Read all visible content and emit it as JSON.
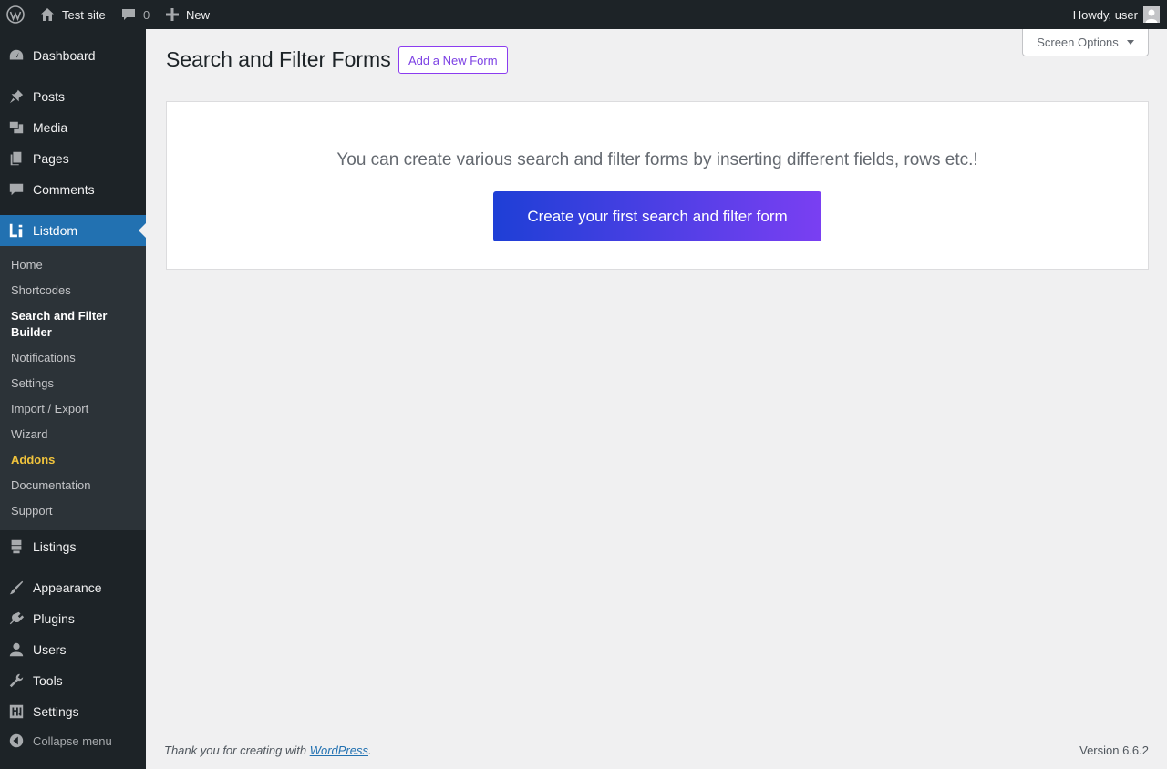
{
  "adminbar": {
    "site_name": "Test site",
    "comments_count": "0",
    "new_label": "New",
    "howdy": "Howdy, user"
  },
  "sidebar": {
    "dashboard": "Dashboard",
    "posts": "Posts",
    "media": "Media",
    "pages": "Pages",
    "comments": "Comments",
    "listdom": "Listdom",
    "submenu": {
      "home": "Home",
      "shortcodes": "Shortcodes",
      "search_filter_builder": "Search and Filter Builder",
      "notifications": "Notifications",
      "settings": "Settings",
      "import_export": "Import / Export",
      "wizard": "Wizard",
      "addons": "Addons",
      "documentation": "Documentation",
      "support": "Support"
    },
    "listings": "Listings",
    "appearance": "Appearance",
    "plugins": "Plugins",
    "users": "Users",
    "tools": "Tools",
    "settings": "Settings",
    "collapse": "Collapse menu"
  },
  "main": {
    "screen_options": "Screen Options",
    "page_title": "Search and Filter Forms",
    "add_new_label": "Add a New Form",
    "card_message": "You can create various search and filter forms by inserting different fields, rows etc.!",
    "create_button": "Create your first search and filter form"
  },
  "footer": {
    "thanks_prefix": "Thank you for creating with ",
    "wordpress_link": "WordPress",
    "thanks_suffix": ".",
    "version": "Version 6.6.2"
  },
  "colors": {
    "accent": "#2271b1",
    "sidebar_bg": "#1d2327",
    "button_gradient_start": "#1e3fd6",
    "button_gradient_end": "#7a3ff2",
    "addons": "#f0c33c"
  }
}
